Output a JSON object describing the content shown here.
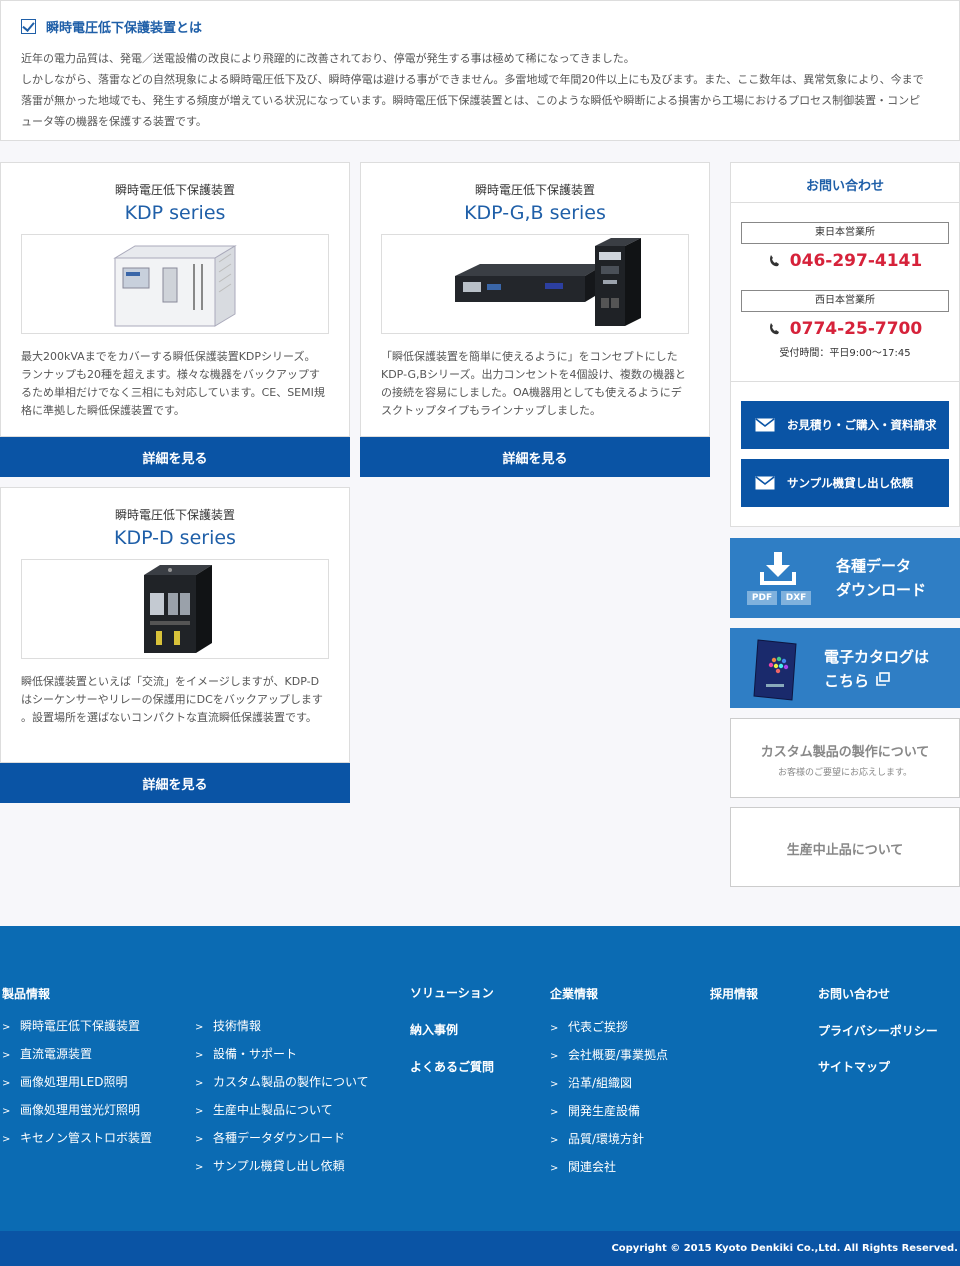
{
  "intro": {
    "title": "瞬時電圧低下保護装置とは",
    "lines": [
      "近年の電力品質は、発電／送電設備の改良により飛躍的に改善されており、停電が発生する事は極めて稀になってきました。",
      "しかしながら、落雷などの自然現象による瞬時電圧低下及び、瞬時停電は避ける事ができません。多雷地域で年間20件以上にも及びます。また、ここ数年は、異常気象により、今まで",
      "落雷が無かった地域でも、発生する頻度が増えている状況になっています。瞬時電圧低下保護装置とは、このような瞬低や瞬断による損害から工場におけるプロセス制御装置・コンピ",
      "ュータ等の機器を保護する装置です。"
    ]
  },
  "products": [
    {
      "sub": "瞬時電圧低下保護装置",
      "name": "KDP series",
      "desc": [
        "最大200kVAまでをカバーする瞬低保護装置KDPシリーズ。",
        "ランナップも20種を超えます。様々な機器をバックアップす",
        "るため単相だけでなく三相にも対応しています。CE、SEMI規",
        "格に準拠した瞬低保護装置です。"
      ],
      "button": "詳細を見る"
    },
    {
      "sub": "瞬時電圧低下保護装置",
      "name": "KDP-G,B series",
      "desc": [
        "「瞬低保護装置を簡単に使えるように」をコンセプトにした",
        "KDP-G,Bシリーズ。出力コンセントを4個設け、複数の機器と",
        "の接続を容易にしました。OA機器用としても使えるようにデ",
        "スクトップタイプもラインナップしました。"
      ],
      "button": "詳細を見る"
    },
    {
      "sub": "瞬時電圧低下保護装置",
      "name": "KDP-D series",
      "desc": [
        "瞬低保護装置といえば「交流」をイメージしますが、KDP-D",
        "はシーケンサーやリレーの保護用にDCをバックアップします",
        "。設置場所を選ばないコンパクトな直流瞬低保護装置です。"
      ],
      "button": "詳細を見る"
    }
  ],
  "contact": {
    "title": "お問い合わせ",
    "east_office": "東日本営業所",
    "east_phone": "046-297-4141",
    "west_office": "西日本営業所",
    "west_phone": "0774-25-7700",
    "hours": "受付時間：平日9:00〜17:45",
    "quote_button": "お見積り・ご購入・資料請求",
    "sample_button": "サンプル機貸し出し依頼"
  },
  "download_banner": {
    "line1": "各種データ",
    "line2": "ダウンロード",
    "pdf": "PDF",
    "dxf": "DXF"
  },
  "catalog_banner": {
    "line1": "電子カタログは",
    "line2": "こちら"
  },
  "custom_box": {
    "title": "カスタム製品の製作について",
    "sub": "お客様のご要望にお応えします。"
  },
  "discontinued_box": {
    "title": "生産中止品について"
  },
  "footer": {
    "products_title": "製品情報",
    "products_col1": [
      "瞬時電圧低下保護装置",
      "直流電源装置",
      "画像処理用LED照明",
      "画像処理用蛍光灯照明",
      "キセノン管ストロボ装置"
    ],
    "products_col2": [
      "技術情報",
      "設備・サポート",
      "カスタム製品の製作について",
      "生産中止製品について",
      "各種データダウンロード",
      "サンプル機貸し出し依頼"
    ],
    "solutions_title": "ソリューション",
    "solutions": [
      "納入事例",
      "よくあるご質問"
    ],
    "company_title": "企業情報",
    "company": [
      "代表ご挨拶",
      "会社概要/事業拠点",
      "沿革/組織図",
      "開発生産設備",
      "品質/環境方針",
      "関連会社"
    ],
    "recruit_title": "採用情報",
    "contact_title": "お問い合わせ",
    "misc": [
      "プライバシーポリシー",
      "サイトマップ"
    ],
    "arrow": ">"
  },
  "copyright": "Copyright © 2015 Kyoto Denkiki Co.,Ltd. All Rights Reserved.",
  "colors": {
    "brand_blue": "#0a54a5",
    "title_blue": "#1f5fa8",
    "phone_red": "#d6223a",
    "footer_blue": "#0b6bb3"
  }
}
